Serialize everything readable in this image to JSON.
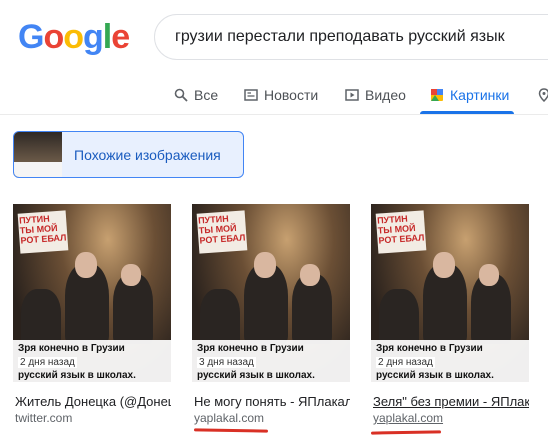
{
  "search": {
    "query": "грузии перестали преподавать русский язык"
  },
  "logo": {
    "letters": [
      "G",
      "o",
      "o",
      "g",
      "l",
      "e"
    ],
    "colors": [
      "#4285f4",
      "#ea4335",
      "#fbbc05",
      "#4285f4",
      "#34a853",
      "#ea4335"
    ]
  },
  "tabs": [
    {
      "label": "Все",
      "icon": "search-icon"
    },
    {
      "label": "Новости",
      "icon": "news-icon"
    },
    {
      "label": "Видео",
      "icon": "video-icon"
    },
    {
      "label": "Картинки",
      "icon": "images-icon",
      "active": true
    }
  ],
  "similar": {
    "label": "Похожие изображения"
  },
  "results": [
    {
      "poster": "ПУТИН\nТЫ МОЙ\nРОТ ЕБАЛ",
      "overlay_title": "Зря конечно в Грузии",
      "overlay_time": "2 дня назад",
      "overlay_cut": "русский язык в школах.",
      "title": "Житель Донецка (@Донецк...",
      "source": "twitter.com"
    },
    {
      "poster": "ПУТИН\nТЫ МОЙ\nРОТ ЕБАЛ",
      "overlay_title": "Зря конечно в Грузии",
      "overlay_time": "3 дня назад",
      "overlay_cut": "русский язык в школах.",
      "title": "Не могу понять - ЯПлакал",
      "source": "yaplakal.com"
    },
    {
      "poster": "ПУТИН\nТЫ МОЙ\nРОТ ЕБАЛ",
      "overlay_title": "Зря конечно в Грузии",
      "overlay_time": "2 дня назад",
      "overlay_cut": "русский язык в школах.",
      "title": "Зеля\" без премии - ЯПлакал",
      "source": "yaplakal.com"
    }
  ],
  "colors": {
    "accent": "#1a73e8",
    "underline": "#d93025"
  }
}
